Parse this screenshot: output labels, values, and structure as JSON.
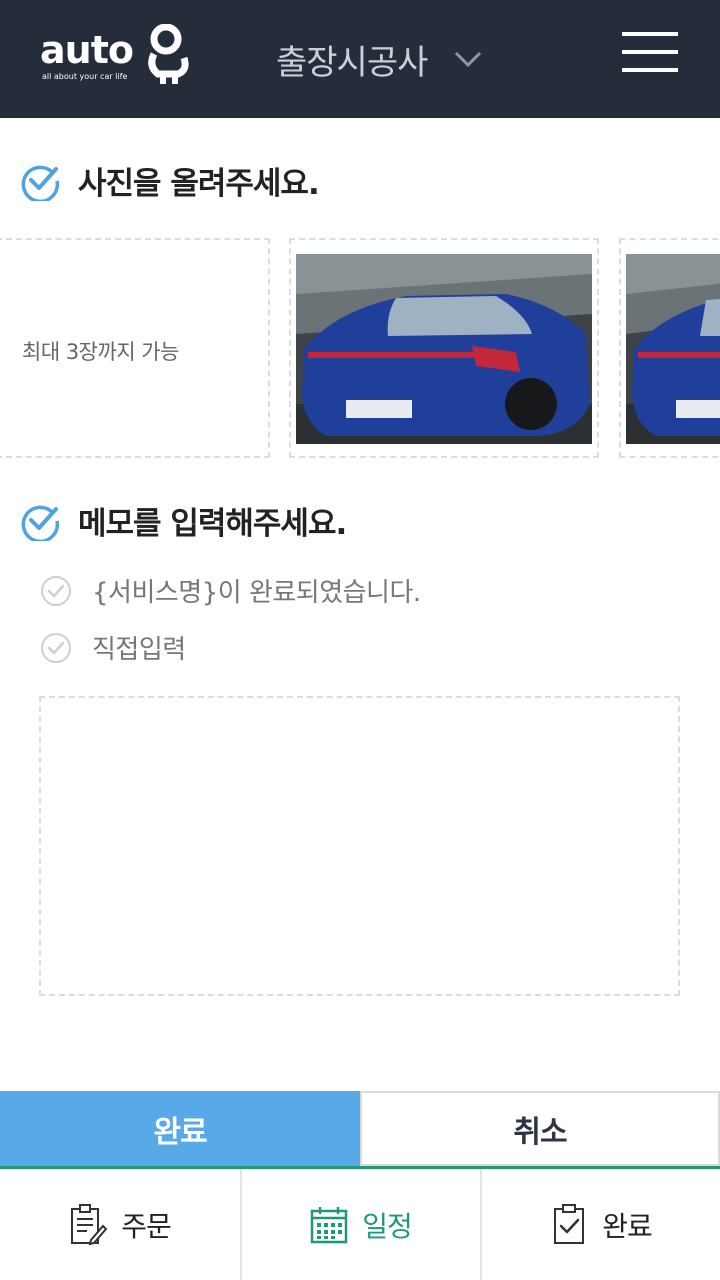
{
  "header": {
    "logo_text": "auto",
    "logo_tagline": "all about your car life",
    "title": "출장시공사"
  },
  "photos": {
    "section_title": "사진을 올려주세요.",
    "hint": "최대 3장까지 가능",
    "count": 2
  },
  "memo": {
    "section_title": "메모를 입력해주세요.",
    "options": [
      {
        "label": "{서비스명}이 완료되였습니다."
      },
      {
        "label": "직접입력"
      }
    ],
    "textarea_value": ""
  },
  "actions": {
    "complete_label": "완료",
    "cancel_label": "취소"
  },
  "bottom_nav": {
    "items": [
      {
        "label": "주문",
        "icon": "clipboard-edit-icon",
        "active": false
      },
      {
        "label": "일정",
        "icon": "calendar-icon",
        "active": true
      },
      {
        "label": "완료",
        "icon": "clipboard-check-icon",
        "active": false
      }
    ]
  },
  "colors": {
    "header_bg": "#252d3a",
    "accent_blue": "#58a9e8",
    "accent_green": "#1d9a75"
  }
}
